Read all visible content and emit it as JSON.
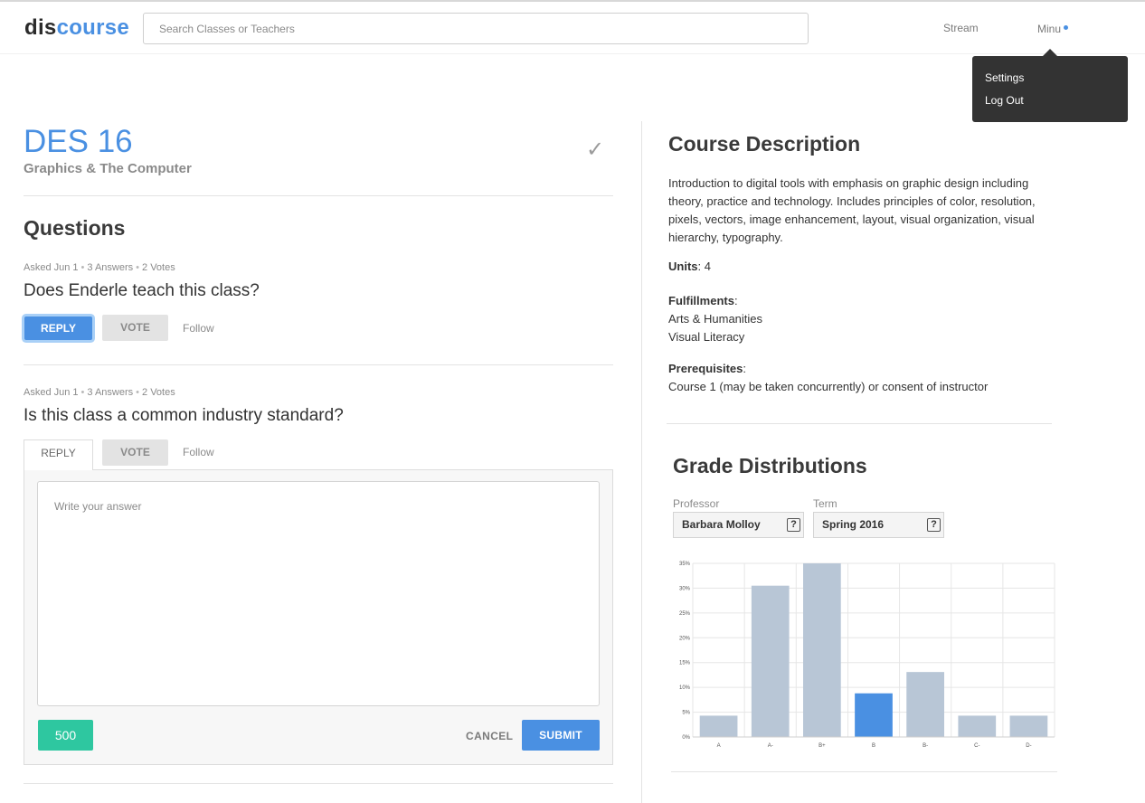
{
  "header": {
    "logo_part1": "dis",
    "logo_part2": "course",
    "search_placeholder": "Search Classes or Teachers",
    "nav_stream": "Stream",
    "nav_user": "Minu"
  },
  "user_menu": {
    "items": [
      "Settings",
      "Log Out"
    ]
  },
  "course": {
    "code": "DES 16",
    "name": "Graphics & The Computer",
    "check_glyph": "✓"
  },
  "questions": {
    "title": "Questions",
    "items": [
      {
        "asked": "Asked Jun 1",
        "answers": "3 Answers",
        "votes": "2 Votes",
        "text": "Does Enderle teach this class?",
        "reply_label": "REPLY",
        "vote_label": "VOTE",
        "follow_label": "Follow"
      },
      {
        "asked": "Asked Jun 1",
        "answers": "3 Answers",
        "votes": "2 Votes",
        "text": "Is this class a common industry standard?",
        "reply_label": "REPLY",
        "vote_label": "VOTE",
        "follow_label": "Follow"
      }
    ],
    "answer_form": {
      "placeholder": "Write your answer",
      "char_count": "500",
      "cancel_label": "CANCEL",
      "submit_label": "SUBMIT"
    }
  },
  "course_description": {
    "title": "Course Description",
    "text": "Introduction to digital tools with emphasis on graphic design including theory, practice and technology. Includes principles of color, resolution, pixels, vectors, image enhancement, layout, visual organization, visual hierarchy, typography.",
    "units_label": "Units",
    "units_value": "4",
    "fulfillments_label": "Fulfillments",
    "fulfillments": [
      "Arts & Humanities",
      "Visual Literacy"
    ],
    "prerequisites_label": "Prerequisites",
    "prerequisites_value": "Course 1 (may be taken concurrently) or consent of instructor"
  },
  "grade_distributions": {
    "title": "Grade Distributions",
    "professor_label": "Professor",
    "professor_value": "Barbara Molloy",
    "term_label": "Term",
    "term_value": "Spring 2016",
    "help_glyph": "?"
  },
  "colors": {
    "accent": "#4a90e2",
    "bar_default": "#b8c6d6",
    "bar_highlight": "#4a90e2",
    "count_badge": "#2ec7a0"
  },
  "chart_data": {
    "type": "bar",
    "categories": [
      "A",
      "A-",
      "B+",
      "B",
      "B-",
      "C-",
      "D-"
    ],
    "values": [
      4.3,
      30.5,
      35,
      8.8,
      13.1,
      4.3,
      4.3
    ],
    "highlight_category": "B",
    "yticks": [
      "0%",
      "5%",
      "10%",
      "15%",
      "20%",
      "25%",
      "30%",
      "35%"
    ],
    "ylim": [
      0,
      35
    ],
    "grid": true,
    "title": "",
    "xlabel": "",
    "ylabel": ""
  }
}
